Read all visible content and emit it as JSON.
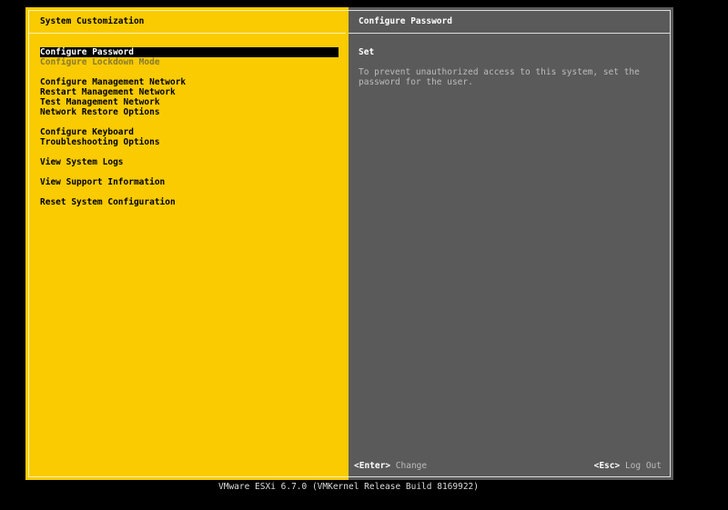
{
  "left": {
    "title": "System Customization",
    "menu": [
      {
        "label": "Configure Password",
        "state": "selected"
      },
      {
        "label": "Configure Lockdown Mode",
        "state": "disabled"
      },
      {
        "label": "Configure Management Network"
      },
      {
        "label": "Restart Management Network"
      },
      {
        "label": "Test Management Network"
      },
      {
        "label": "Network Restore Options"
      },
      {
        "label": "Configure Keyboard"
      },
      {
        "label": "Troubleshooting Options"
      },
      {
        "label": "View System Logs"
      },
      {
        "label": "View Support Information"
      },
      {
        "label": "Reset System Configuration"
      }
    ]
  },
  "right": {
    "title": "Configure Password",
    "status": "Set",
    "description": "To prevent unauthorized access to this system, set the password for the user.",
    "footer": {
      "enter_key": "<Enter>",
      "enter_action": "Change",
      "esc_key": "<Esc>",
      "esc_action": "Log Out"
    }
  },
  "version": "VMware ESXi 6.7.0 (VMKernel Release Build 8169922)"
}
